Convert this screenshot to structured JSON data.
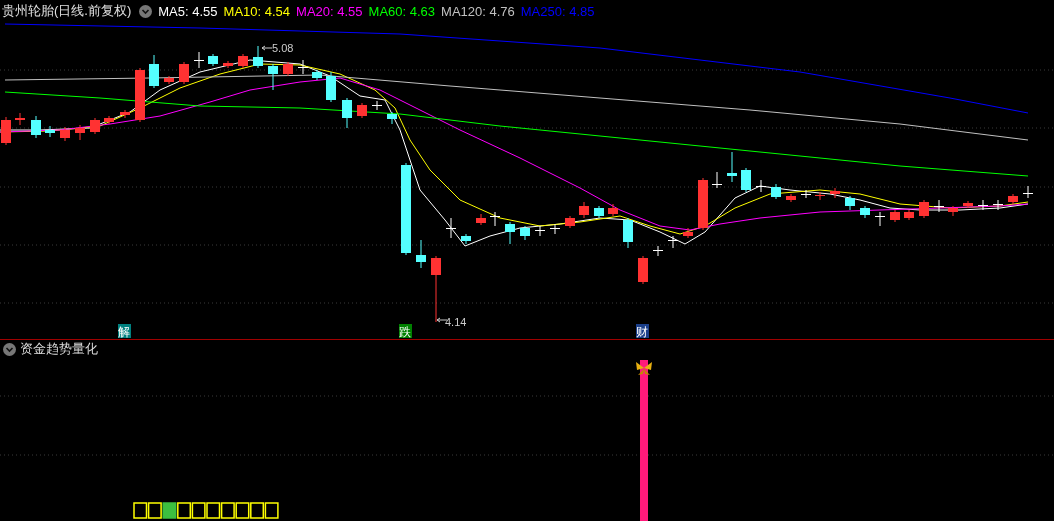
{
  "header": {
    "title": "贵州轮胎(日线.前复权)",
    "indicators": [
      {
        "label": "MA5: 4.55",
        "color": "#ffffff"
      },
      {
        "label": "MA10: 4.54",
        "color": "#ffff00"
      },
      {
        "label": "MA20: 4.55",
        "color": "#ff00ff"
      },
      {
        "label": "MA60: 4.63",
        "color": "#00ff00"
      },
      {
        "label": "MA120: 4.76",
        "color": "#c0c0c0"
      },
      {
        "label": "MA250: 4.85",
        "color": "#0000ff"
      }
    ]
  },
  "price_labels": [
    "5.08",
    "4.14"
  ],
  "signals": [
    {
      "text": "解",
      "color": "#00807f"
    },
    {
      "text": "跌",
      "color": "#008000"
    },
    {
      "text": "财",
      "color": "#1b3f8a"
    }
  ],
  "lower_panel": {
    "title": "资金趋势量化",
    "boxes": [
      {
        "filled": false
      },
      {
        "filled": false
      },
      {
        "filled": true
      },
      {
        "filled": false
      },
      {
        "filled": false
      },
      {
        "filled": false
      },
      {
        "filled": false
      },
      {
        "filled": false
      },
      {
        "filled": false
      },
      {
        "filled": false
      }
    ]
  }
}
